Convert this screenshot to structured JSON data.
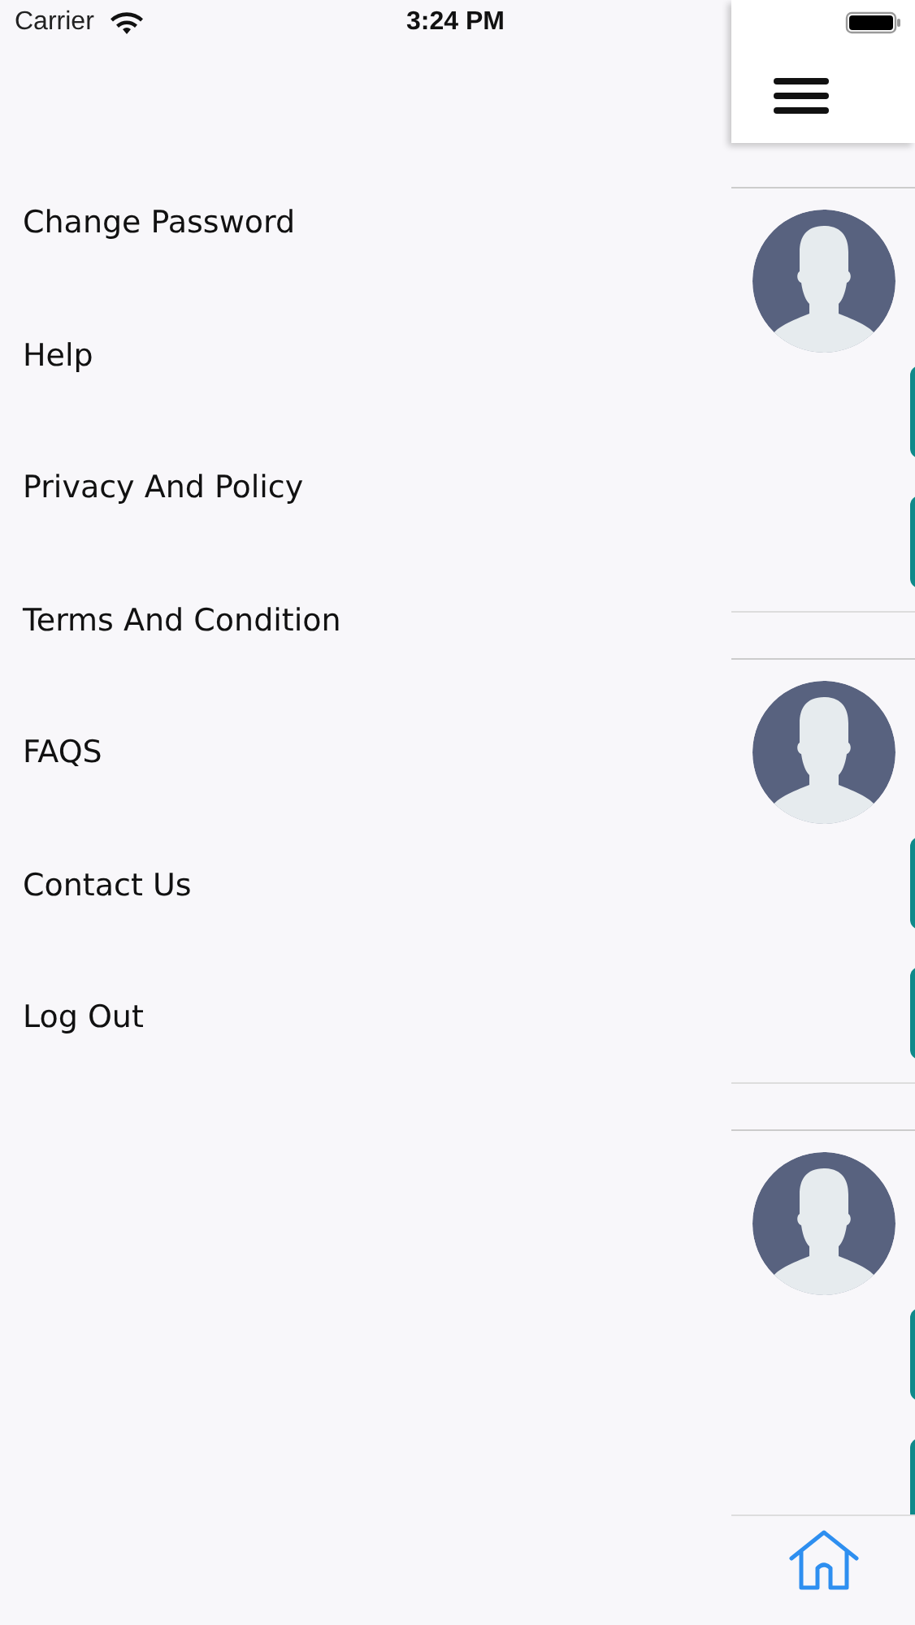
{
  "status_bar": {
    "carrier": "Carrier",
    "time": "3:24 PM"
  },
  "menu": [
    {
      "label": "Change Password"
    },
    {
      "label": "Help"
    },
    {
      "label": "Privacy And Policy"
    },
    {
      "label": "Terms And Condition"
    },
    {
      "label": "FAQS"
    },
    {
      "label": "Contact Us"
    },
    {
      "label": "Log Out"
    }
  ],
  "cards": [
    {
      "kind": "profile"
    },
    {
      "kind": "profile"
    },
    {
      "kind": "profile"
    }
  ],
  "tab_bar": [
    {
      "kind": "home",
      "selected": true
    }
  ]
}
